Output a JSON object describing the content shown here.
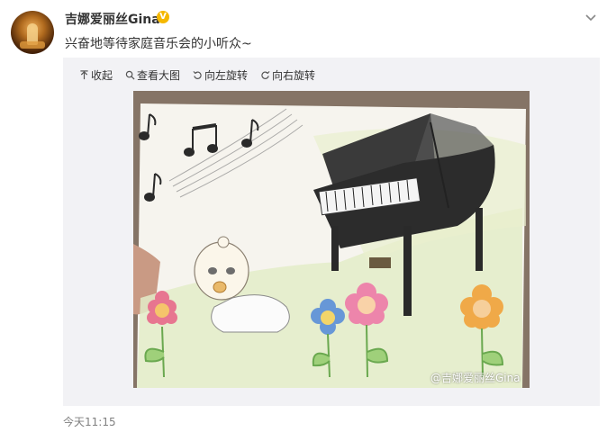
{
  "post": {
    "username": "吉娜爱丽丝Gina",
    "verified_icon": "verified-v-icon",
    "verified_mark": "V",
    "text": "兴奋地等待家庭音乐会的小听众~",
    "timestamp": "今天11:15"
  },
  "toolbar": {
    "collapse_label": "收起",
    "view_large_label": "查看大图",
    "rotate_left_label": "向左旋转",
    "rotate_right_label": "向右旋转"
  },
  "image": {
    "description_icon": "drawing-image",
    "watermark": "@吉娜爱丽丝Gina"
  },
  "colors": {
    "verified": "#f5b800",
    "media_bg": "#f2f2f5",
    "timestamp": "#808080"
  }
}
